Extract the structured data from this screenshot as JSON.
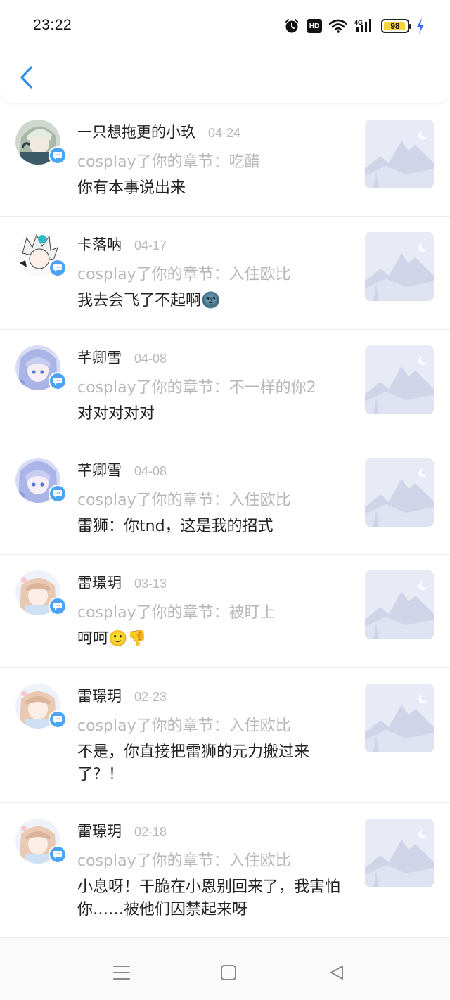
{
  "status": {
    "time": "23:22",
    "hd": "HD",
    "network": "4G",
    "battery": "98",
    "icons": [
      "alarm-icon",
      "hd-icon",
      "wifi-icon",
      "signal-icon",
      "battery-icon",
      "charging-icon"
    ]
  },
  "header": {
    "back_icon": "chevron-left-icon"
  },
  "comments": [
    {
      "name": "一只想拖更的小玖",
      "date": "04-24",
      "chapter": "cosplay了你的章节：吃醋",
      "text": "你有本事说出来"
    },
    {
      "name": "卡落呐",
      "date": "04-17",
      "chapter": "cosplay了你的章节：入住欧比",
      "text": "我去会飞了不起啊",
      "emoji": "🌚"
    },
    {
      "name": "芊卿雪",
      "date": "04-08",
      "chapter": "cosplay了你的章节：不一样的你2",
      "text": "对对对对对"
    },
    {
      "name": "芊卿雪",
      "date": "04-08",
      "chapter": "cosplay了你的章节：入住欧比",
      "text": "雷狮：你tnd，这是我的招式"
    },
    {
      "name": "雷璟玥",
      "date": "03-13",
      "chapter": "cosplay了你的章节：被盯上",
      "text": "呵呵",
      "emoji": "🙂👎"
    },
    {
      "name": "雷璟玥",
      "date": "02-23",
      "chapter": "cosplay了你的章节：入住欧比",
      "text": "不是，你直接把雷狮的元力搬过来了？！"
    },
    {
      "name": "雷璟玥",
      "date": "02-18",
      "chapter": "cosplay了你的章节：入住欧比",
      "text": "小息呀！干脆在小恩别回来了，我害怕你……被他们囚禁起来呀"
    }
  ],
  "nav": {
    "icons": [
      "menu-icon",
      "home-square-icon",
      "back-triangle-icon"
    ]
  },
  "colors": {
    "accent": "#4aa3f5",
    "muted": "#b8b8b8",
    "thumb_bg": "#e8ebf6"
  }
}
